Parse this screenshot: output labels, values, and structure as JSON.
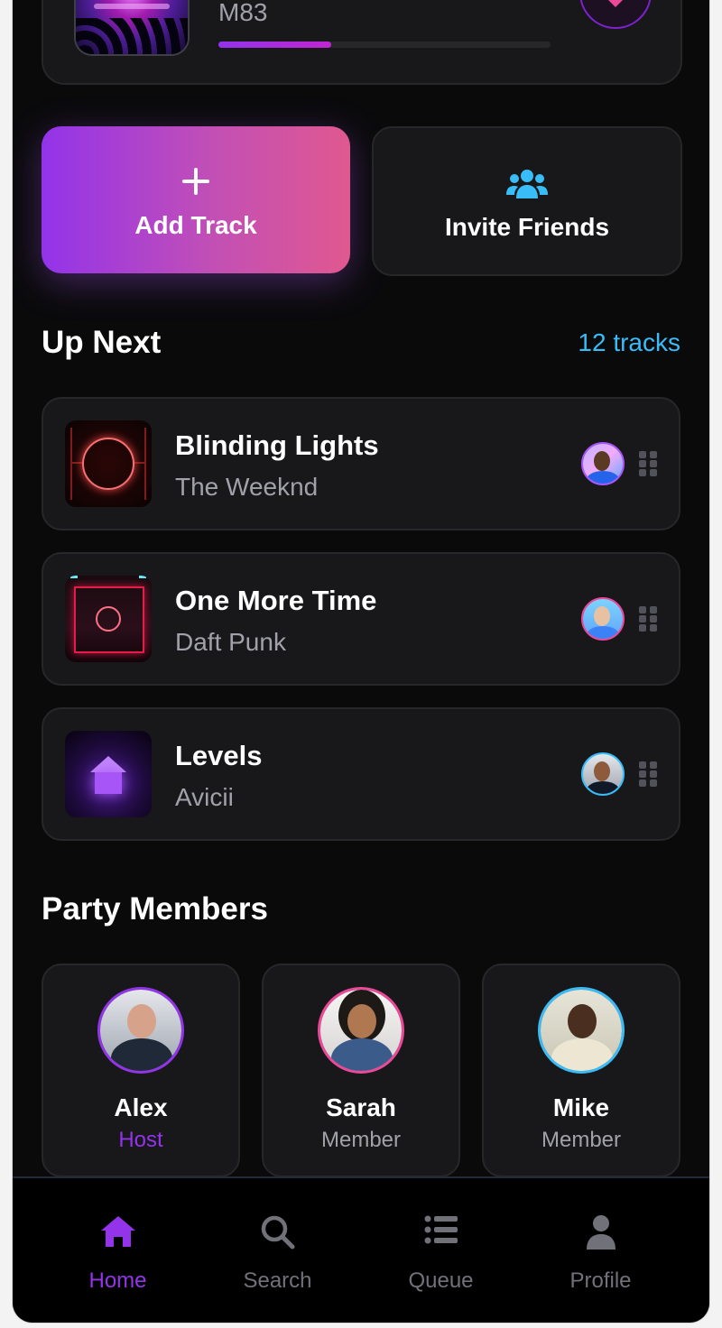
{
  "now_playing": {
    "artist": "M83",
    "progress_percent": 34,
    "like_icon": "heart-icon"
  },
  "actions": {
    "add_track": {
      "label": "Add Track",
      "icon": "plus-icon"
    },
    "invite_friends": {
      "label": "Invite Friends",
      "icon": "users-icon"
    }
  },
  "up_next": {
    "title": "Up Next",
    "count": "12 tracks",
    "tracks": [
      {
        "title": "Blinding Lights",
        "artist": "The Weeknd"
      },
      {
        "title": "One More Time",
        "artist": "Daft Punk"
      },
      {
        "title": "Levels",
        "artist": "Avicii"
      }
    ]
  },
  "party": {
    "title": "Party Members",
    "members": [
      {
        "name": "Alex",
        "role": "Host"
      },
      {
        "name": "Sarah",
        "role": "Member"
      },
      {
        "name": "Mike",
        "role": "Member"
      }
    ]
  },
  "nav": {
    "items": [
      {
        "label": "Home",
        "icon": "home-icon",
        "active": true
      },
      {
        "label": "Search",
        "icon": "search-icon",
        "active": false
      },
      {
        "label": "Queue",
        "icon": "list-icon",
        "active": false
      },
      {
        "label": "Profile",
        "icon": "user-icon",
        "active": false
      }
    ]
  },
  "colors": {
    "background": "#0a0a0b",
    "card": "#18181b",
    "accent_purple": "#9333ea",
    "accent_pink": "#ec4899",
    "accent_cyan": "#38bdf8"
  }
}
